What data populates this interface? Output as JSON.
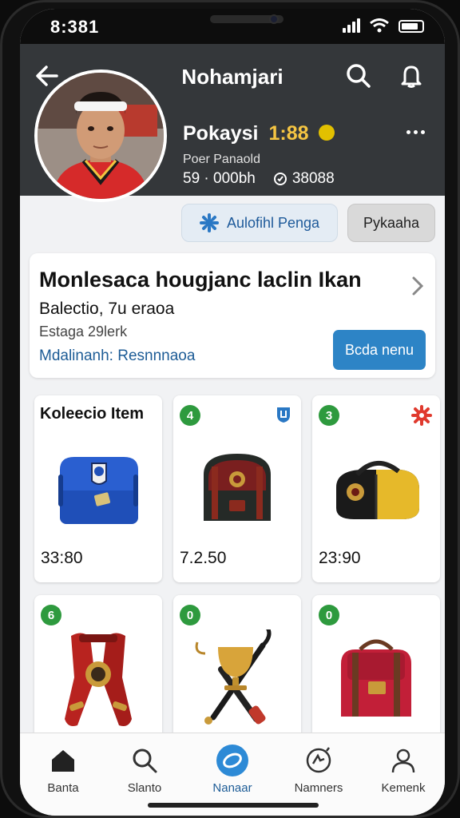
{
  "status": {
    "time": "8:381"
  },
  "header": {
    "title": "Nohamjari",
    "back_icon": "arrow-left-icon",
    "search_icon": "search-icon",
    "bell_icon": "bell-icon"
  },
  "profile": {
    "name": "Pokaysi",
    "badge": "1:88",
    "subtitle": "Poer Panaold",
    "stats": [
      "59 · 000bh",
      "38088"
    ],
    "primary_button": "Aulofihl Penga",
    "secondary_button": "Pykaaha"
  },
  "info_card": {
    "title": "Monlesaca hougjanc laclin Ikan",
    "line1": "Balectio, 7u eraoa",
    "line2": "Estaga 29lerk",
    "link": "Mdalinanh: Resnnnaoa",
    "button": "Bcda nenu"
  },
  "items": [
    {
      "heading": "Koleecio Item",
      "badge": "",
      "price": "33:80"
    },
    {
      "heading": "",
      "badge": "4",
      "price": "7.2.50"
    },
    {
      "heading": "",
      "badge": "3",
      "price": "23:90"
    },
    {
      "heading": "",
      "badge": "6",
      "price": ""
    },
    {
      "heading": "",
      "badge": "0",
      "price": ""
    },
    {
      "heading": "",
      "badge": "0",
      "price": ""
    }
  ],
  "nav": [
    {
      "label": "Banta",
      "icon": "home-icon"
    },
    {
      "label": "Slanto",
      "icon": "search-icon"
    },
    {
      "label": "Nanaar",
      "icon": "compass-icon"
    },
    {
      "label": "Namners",
      "icon": "badge-icon"
    },
    {
      "label": "Kemenk",
      "icon": "profile-icon"
    }
  ],
  "colors": {
    "header": "#34373a",
    "accent": "#2d84c6",
    "badge": "#2e9a3e",
    "gold": "#f5c542"
  }
}
